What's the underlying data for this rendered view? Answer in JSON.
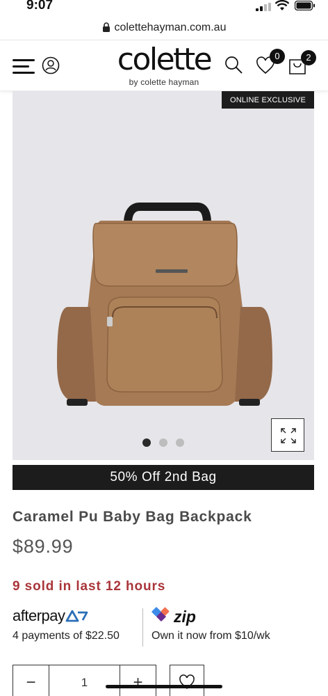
{
  "status_bar": {
    "time": "9:07"
  },
  "browser": {
    "url": "colettehayman.com.au"
  },
  "header": {
    "logo_text": "colette",
    "logo_subtitle": "by colette hayman",
    "wishlist_count": "0",
    "cart_count": "2",
    "icons": [
      "menu-icon",
      "account-icon",
      "search-icon",
      "heart-icon",
      "bag-icon"
    ]
  },
  "product": {
    "badge": "ONLINE EXCLUSIVE",
    "image_count": 3,
    "active_image": 1,
    "promo": "50% Off 2nd Bag",
    "title": "Caramel Pu Baby Bag Backpack",
    "price": "$89.99",
    "sold_notice": "9 sold in last 12 hours"
  },
  "payments": {
    "afterpay": {
      "logo": "afterpay",
      "text": "4 payments of $22.50"
    },
    "zip": {
      "logo": "zip",
      "text": "Own it now from $10/wk"
    }
  },
  "quantity": {
    "minus": "−",
    "value": "1",
    "plus": "+"
  },
  "colors": {
    "accent_dark": "#1c1c1c",
    "sold_red": "#a9353a",
    "image_bg": "#e6e5e9",
    "bag_caramel": "#a57a55",
    "afterpay_mint": "#2b6fb7",
    "zip_purple": "#6a2c91"
  }
}
